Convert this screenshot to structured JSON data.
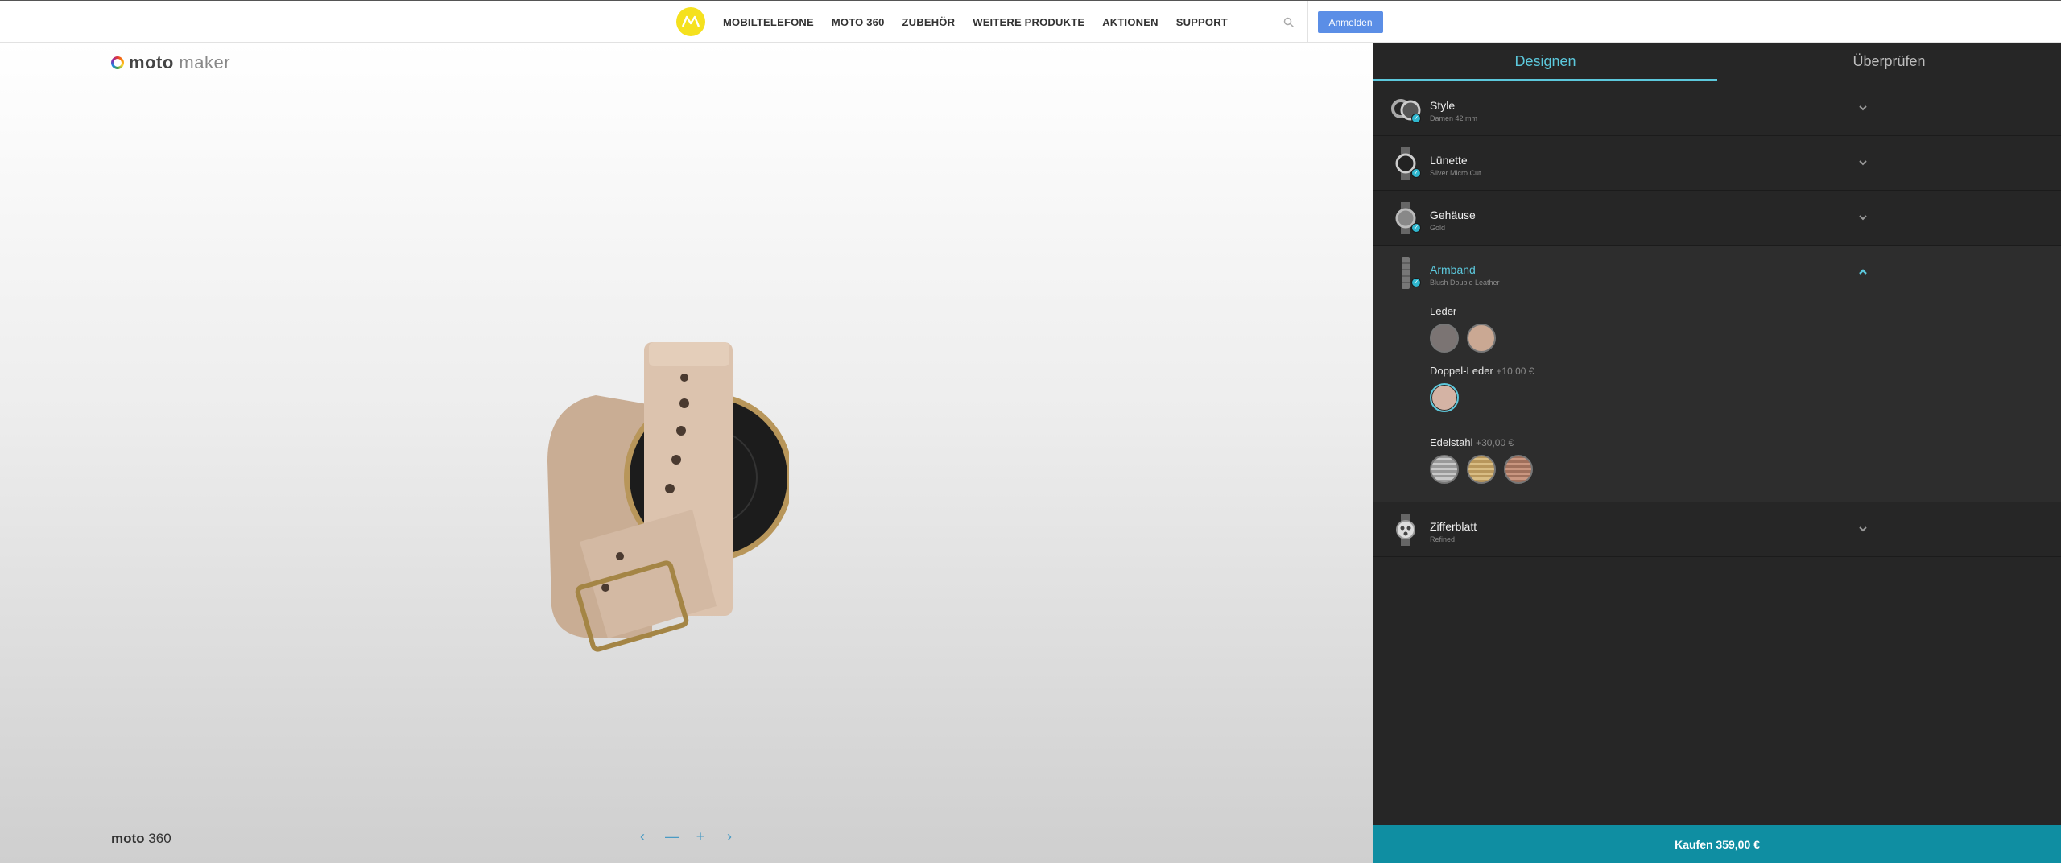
{
  "nav": {
    "items": [
      "MOBILTELEFONE",
      "MOTO 360",
      "ZUBEHÖR",
      "WEITERE PRODUKTE",
      "AKTIONEN",
      "SUPPORT"
    ],
    "login_label": "Anmelden",
    "logo_icon": "motorola-logo-icon",
    "search_icon": "search-icon"
  },
  "brand": {
    "moto": "moto",
    "maker": "maker"
  },
  "product": {
    "moto": "moto",
    "model": "360"
  },
  "viewer": {
    "prev": "‹",
    "zoom_out": "—",
    "zoom_in": "+",
    "next": "›"
  },
  "tabs": {
    "design": "Designen",
    "review": "Überprüfen"
  },
  "sections": [
    {
      "title": "Style",
      "subtitle": "Damen 42 mm"
    },
    {
      "title": "Lünette",
      "subtitle": "Silver Micro Cut"
    },
    {
      "title": "Gehäuse",
      "subtitle": "Gold"
    },
    {
      "title": "Armband",
      "subtitle": "Blush Double Leather"
    },
    {
      "title": "Zifferblatt",
      "subtitle": "Refined"
    }
  ],
  "band_groups": {
    "leather": {
      "label": "Leder",
      "swatches": [
        "#7b7473",
        "#caa893"
      ]
    },
    "double_leather": {
      "label": "Doppel-Leder",
      "price": "+10,00 €",
      "swatches": [
        "#d4b3a4"
      ]
    },
    "steel": {
      "label": "Edelstahl",
      "price": "+30,00 €",
      "swatches": [
        "#9a9a9a",
        "#b8975c",
        "#a0705c"
      ]
    }
  },
  "colors": {
    "accent": "#5cc8dc",
    "buy": "#0f8ea2",
    "login": "#5b8ee6"
  },
  "buy": {
    "label": "Kaufen 359,00 €"
  }
}
